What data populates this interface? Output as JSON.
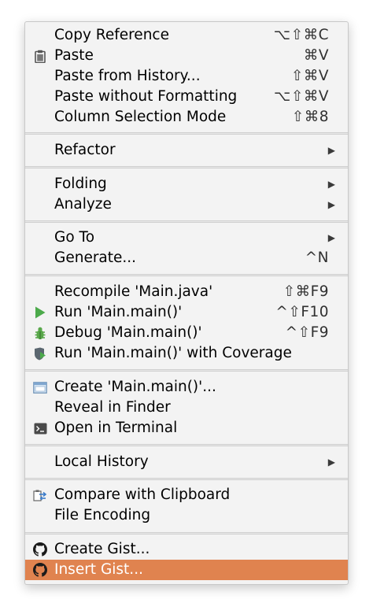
{
  "colors": {
    "highlight": "#e0834f",
    "run_green": "#4caa4b",
    "debug_green": "#59a84b"
  },
  "menu": {
    "copy_reference": {
      "label": "Copy Reference",
      "shortcut": "⌥⇧⌘C"
    },
    "paste": {
      "label": "Paste",
      "shortcut": "⌘V",
      "icon": "clipboard-icon"
    },
    "paste_history": {
      "label": "Paste from History...",
      "shortcut": "⇧⌘V"
    },
    "paste_plain": {
      "label": "Paste without Formatting",
      "shortcut": "⌥⇧⌘V"
    },
    "column_selection": {
      "label": "Column Selection Mode",
      "shortcut": "⇧⌘8"
    },
    "refactor": {
      "label": "Refactor",
      "submenu": "▶"
    },
    "folding": {
      "label": "Folding",
      "submenu": "▶"
    },
    "analyze": {
      "label": "Analyze",
      "submenu": "▶"
    },
    "go_to": {
      "label": "Go To",
      "submenu": "▶"
    },
    "generate": {
      "label": "Generate...",
      "shortcut": "^N"
    },
    "recompile": {
      "label": "Recompile 'Main.java'",
      "shortcut": "⇧⌘F9"
    },
    "run": {
      "label": "Run 'Main.main()'",
      "shortcut": "^⇧F10",
      "icon": "run-icon"
    },
    "debug": {
      "label": "Debug 'Main.main()'",
      "shortcut": "^⇧F9",
      "icon": "debug-bug-icon"
    },
    "run_coverage": {
      "label": "Run 'Main.main()' with Coverage",
      "icon": "coverage-shield-icon"
    },
    "create_config": {
      "label": "Create 'Main.main()'...",
      "icon": "run-config-window-icon"
    },
    "reveal_finder": {
      "label": "Reveal in Finder"
    },
    "open_terminal": {
      "label": "Open in Terminal",
      "icon": "terminal-icon"
    },
    "local_history": {
      "label": "Local History",
      "submenu": "▶"
    },
    "compare_clipboard": {
      "label": "Compare with Clipboard",
      "icon": "compare-icon"
    },
    "file_encoding": {
      "label": "File Encoding"
    },
    "create_gist": {
      "label": "Create Gist...",
      "icon": "github-icon"
    },
    "insert_gist": {
      "label": "Insert Gist...",
      "icon": "github-icon",
      "state": "highlighted"
    }
  }
}
